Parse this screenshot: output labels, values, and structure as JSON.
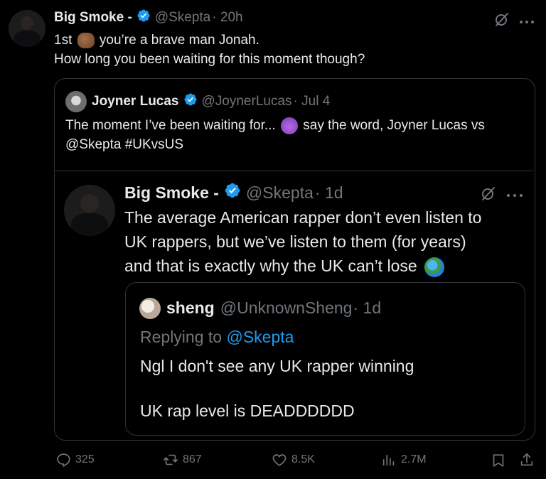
{
  "tweet": {
    "author_name": "Big Smoke -",
    "author_handle": "@Skepta",
    "time": "· 20h",
    "text_prefix": "1st",
    "text_line1_rest": "you’re a brave man Jonah.",
    "text_line2": "How long you been waiting for this moment though?"
  },
  "quote": {
    "author_name": "Joyner Lucas",
    "author_handle": "@JoynerLucas",
    "time": "· Jul 4",
    "line1_before_emoji": "The moment I’ve been waiting for...",
    "line1_after_emoji": "say the word, Joyner Lucas vs",
    "line2": "@Skepta #UKvsUS"
  },
  "inner": {
    "author_name": "Big Smoke -",
    "author_handle": "@Skepta",
    "time": "· 1d",
    "line1": "The average American rapper don’t even listen to",
    "line2": "UK rappers, but we’ve listen to them (for years)",
    "line3": "and that is exactly why the UK can’t lose"
  },
  "reply": {
    "author_name": "sheng",
    "author_handle": "@UnknownSheng",
    "time": "· 1d",
    "replying_label": "Replying to",
    "replying_handle": "@Skepta",
    "line1": "Ngl I don't see any UK rapper winning",
    "line2": "UK rap level is DEADDDDDD"
  },
  "actions": {
    "replies": "325",
    "reposts": "867",
    "likes": "8.5K",
    "views": "2.7M"
  },
  "icons": {
    "verified": "verified-badge-icon",
    "grok": "grok-icon",
    "more": "more-icon",
    "reply": "reply-icon",
    "repost": "repost-icon",
    "like": "heart-icon",
    "views": "views-icon",
    "bookmark": "bookmark-icon",
    "share": "share-icon"
  },
  "colors": {
    "background": "#000000",
    "text": "#e7e9ea",
    "muted": "#71767b",
    "accent": "#1d9bf0",
    "border": "#2f3336"
  }
}
